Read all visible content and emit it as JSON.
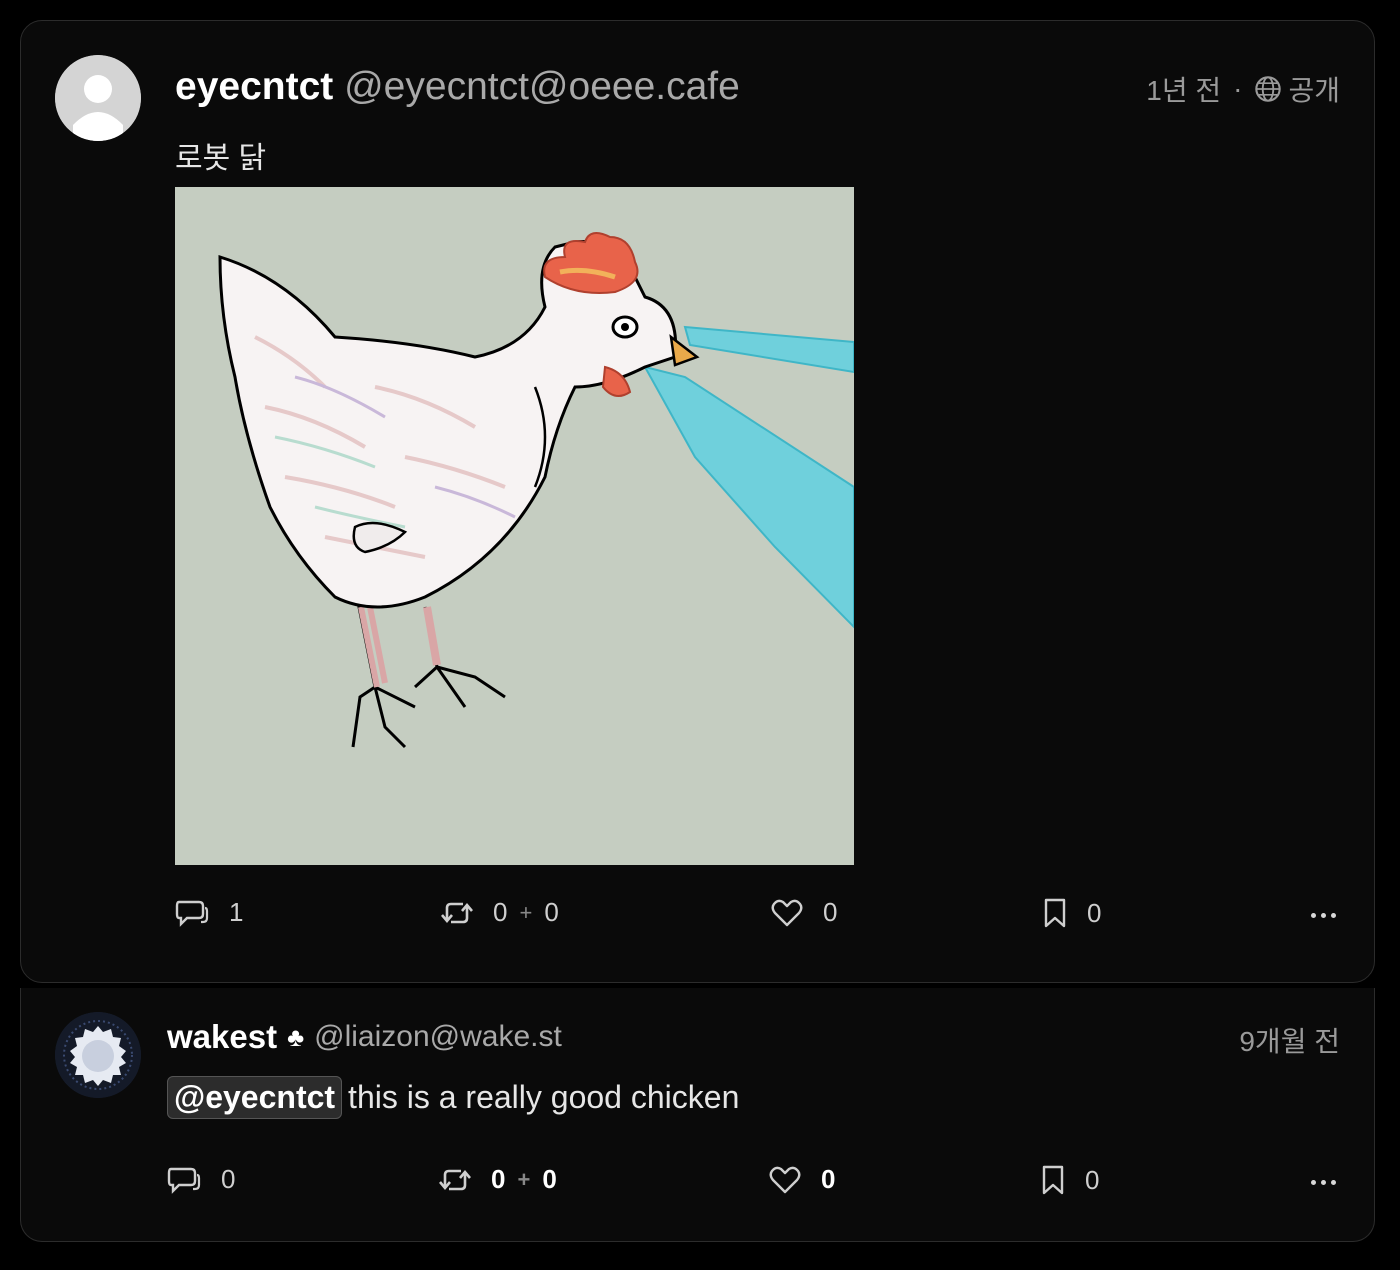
{
  "post": {
    "author_name": "eyecntct",
    "author_handle": "@eyecntct@oeee.cafe",
    "time": "1년 전",
    "separator": "·",
    "visibility": "공개",
    "text": "로봇 닭",
    "image_alt": "drawing of a white chicken with cyan laser beams from its eyes",
    "actions": {
      "replies": "1",
      "boosts": "0",
      "quotes": "0",
      "plus": "+",
      "likes": "0",
      "bookmarks": "0"
    }
  },
  "reply": {
    "author_name": "wakest",
    "author_badge": "♣",
    "author_handle": "@liaizon@wake.st",
    "time": "9개월 전",
    "mention": "@eyecntct",
    "text": "this is a really good chicken",
    "actions": {
      "replies": "0",
      "boosts": "0",
      "quotes": "0",
      "plus": "+",
      "likes": "0",
      "bookmarks": "0"
    }
  },
  "colors": {
    "background": "#000000",
    "card": "#0a0a0a",
    "border": "#2c2c2c",
    "image_bg": "#c5cdc1",
    "laser": "#6fd0dc"
  },
  "icons": [
    "reply-icon",
    "boost-icon",
    "heart-icon",
    "bookmark-icon",
    "more-icon",
    "globe-icon"
  ]
}
